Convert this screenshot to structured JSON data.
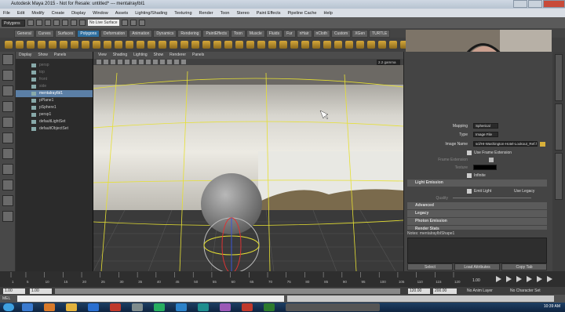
{
  "window": {
    "title": "Autodesk Maya 2015 - Not for Resale: untitled*  ---  mentalrayIbl1"
  },
  "menubar": [
    "File",
    "Edit",
    "Modify",
    "Create",
    "Display",
    "Window",
    "Assets",
    "Lighting/Shading",
    "Texturing",
    "Render",
    "Toon",
    "Stereo",
    "Paint Effects",
    "Pipeline Cache",
    "Help"
  ],
  "statusline": {
    "menuset": "Polygons",
    "live_surface": "No Live Surface"
  },
  "shelf_tabs": [
    "General",
    "Curves",
    "Surfaces",
    "Polygons",
    "Deformation",
    "Animation",
    "Dynamics",
    "Rendering",
    "PaintEffects",
    "Toon",
    "Muscle",
    "Fluids",
    "Fur",
    "nHair",
    "nCloth",
    "Custom",
    "XGen",
    "TURTLE"
  ],
  "shelf_active": "Polygons",
  "outliner": {
    "menu": [
      "Display",
      "Show",
      "Panels"
    ],
    "items": [
      {
        "label": "persp",
        "dim": true
      },
      {
        "label": "top",
        "dim": true
      },
      {
        "label": "front",
        "dim": true
      },
      {
        "label": "side",
        "dim": true
      },
      {
        "label": "mentalrayIbl1",
        "selected": true
      },
      {
        "label": "pPlane1"
      },
      {
        "label": "pSphere1"
      },
      {
        "label": "persp1"
      },
      {
        "label": "defaultLightSet"
      },
      {
        "label": "defaultObjectSet"
      }
    ]
  },
  "viewport": {
    "menu": [
      "View",
      "Shading",
      "Lighting",
      "Show",
      "Renderer",
      "Panels"
    ],
    "gamma": "2.2 gamma"
  },
  "attribute_editor": {
    "mapping_label": "Mapping",
    "mapping_value": "Spherical",
    "type_label": "Type",
    "type_value": "Image File",
    "image_name_label": "Image Name",
    "image_name_value": "scl/HI-Washington-Hotel-Lookout_Ref.hdr",
    "use_frame_ext": "Use Frame Extension",
    "frame_ext_label": "Frame Extension",
    "texture_label": "Texture",
    "infinite": "Infinite",
    "sections": [
      "Light Emission",
      "Advanced",
      "Legacy",
      "Photon Emission",
      "Render Stats"
    ],
    "emit_light": "Emit Light",
    "use_legacy": "Use Legacy",
    "quality_label": "Quality",
    "notes_label": "Notes:  mentalrayIblShape1",
    "buttons": [
      "Select",
      "Load Attributes",
      "Copy Tab"
    ]
  },
  "timeline": {
    "ticks": [
      "1",
      "5",
      "10",
      "15",
      "20",
      "25",
      "30",
      "35",
      "40",
      "45",
      "50",
      "55",
      "60",
      "65",
      "70",
      "75",
      "80",
      "85",
      "90",
      "95",
      "100",
      "105",
      "110",
      "115",
      "120"
    ],
    "current": "1.00"
  },
  "range": {
    "start": "1.00",
    "start2": "1.00",
    "end": "120.00",
    "end2": "200.00",
    "anim_layer": "No Anim Layer",
    "char_set": "No Character Set"
  },
  "cmdline": {
    "label": "MEL"
  },
  "taskbar": {
    "time": "10:39 AM"
  }
}
